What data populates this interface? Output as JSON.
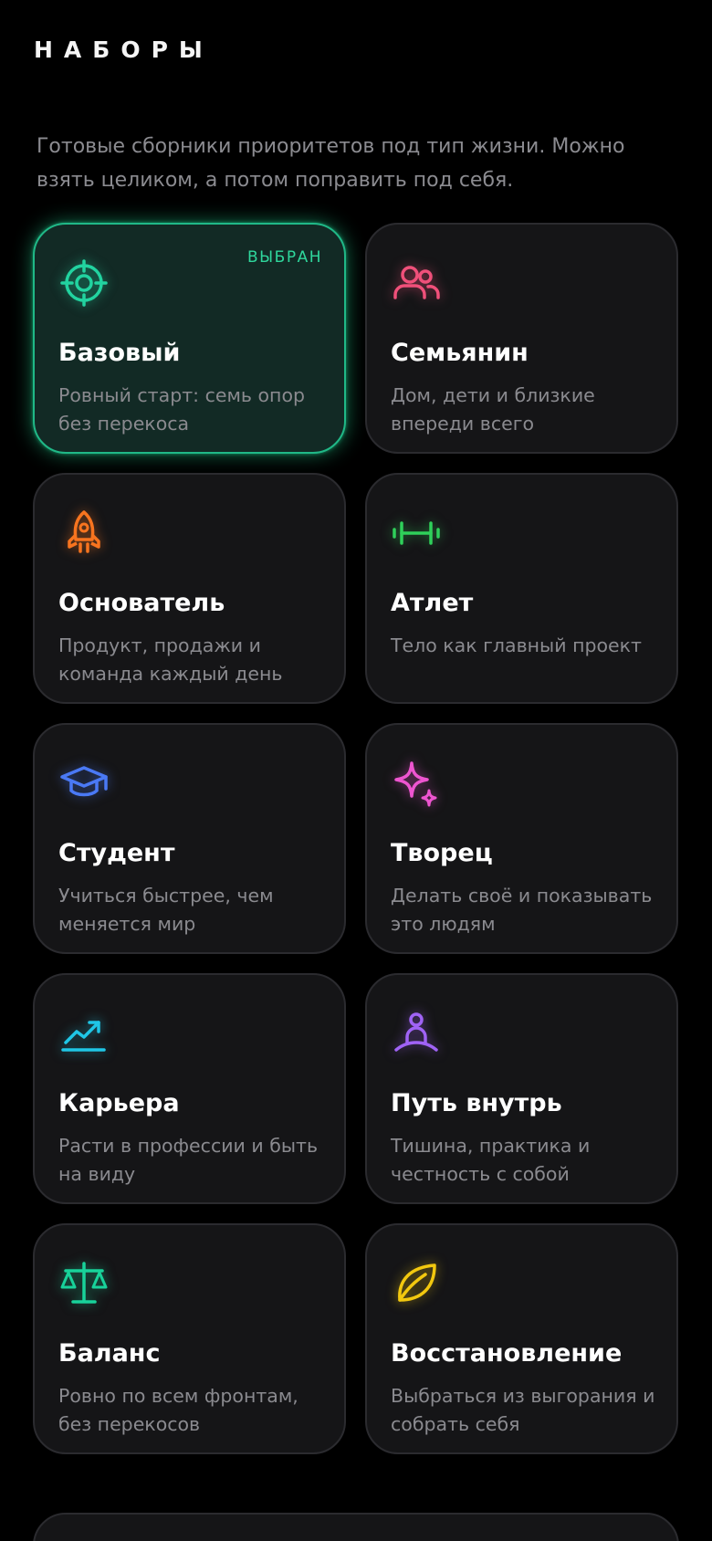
{
  "header": {
    "title": "НАБОРЫ"
  },
  "intro": "Готовые сборники приоритетов под тип жизни. Можно взять целиком, а потом поправить под себя.",
  "badge_selected": "ВЫБРАН",
  "presets": [
    {
      "id": "base",
      "title": "Базовый",
      "desc": "Ровный старт: семь опор без перекоса",
      "icon": "target-icon",
      "color": "#22d3a0",
      "selected": true
    },
    {
      "id": "family",
      "title": "Семьянин",
      "desc": "Дом, дети и близкие впереди всего",
      "icon": "users-icon",
      "color": "#f0507a",
      "selected": false
    },
    {
      "id": "founder",
      "title": "Основатель",
      "desc": "Продукт, продажи и команда каждый день",
      "icon": "rocket-icon",
      "color": "#f7741f",
      "selected": false
    },
    {
      "id": "athlete",
      "title": "Атлет",
      "desc": "Тело как главный проект",
      "icon": "dumbbell-icon",
      "color": "#2fd05a",
      "selected": false
    },
    {
      "id": "student",
      "title": "Студент",
      "desc": "Учиться быстрее, чем меняется мир",
      "icon": "graduation-cap-icon",
      "color": "#4a79f5",
      "selected": false
    },
    {
      "id": "creator",
      "title": "Творец",
      "desc": "Делать своё и показывать это людям",
      "icon": "sparkles-icon",
      "color": "#ee55d0",
      "selected": false
    },
    {
      "id": "career",
      "title": "Карьера",
      "desc": "Расти в профессии и быть на виду",
      "icon": "trending-up-icon",
      "color": "#1fc6e6",
      "selected": false
    },
    {
      "id": "inner",
      "title": "Путь внутрь",
      "desc": "Тишина, практика и честность с собой",
      "icon": "meditation-person-icon",
      "color": "#a063f5",
      "selected": false
    },
    {
      "id": "balance",
      "title": "Баланс",
      "desc": "Ровно по всем фронтам, без перекосов",
      "icon": "scale-icon",
      "color": "#18d29a",
      "selected": false
    },
    {
      "id": "recovery",
      "title": "Восстановление",
      "desc": "Выбраться из выгорания и собрать себя",
      "icon": "leaf-icon",
      "color": "#f2c80f",
      "selected": false
    }
  ]
}
